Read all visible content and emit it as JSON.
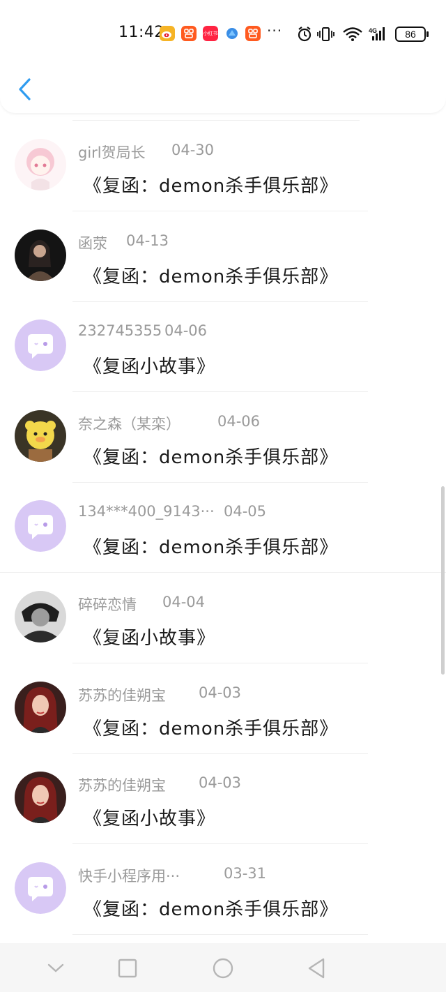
{
  "status_bar": {
    "time": "11:42",
    "network": "4G",
    "battery": "86",
    "overflow": "···",
    "apps": [
      {
        "icon": "weibo-icon",
        "color": "#f5a623"
      },
      {
        "icon": "kuaishou-icon",
        "color": "#ff5a1f"
      },
      {
        "icon": "xiaohongshu-icon",
        "color": "#ff2442",
        "text": "小红书"
      },
      {
        "icon": "browser-icon",
        "color": "#3a8ee6"
      },
      {
        "icon": "kuaishou-icon",
        "color": "#ff5a1f"
      }
    ]
  },
  "header": {
    "back_icon": "chevron-left-icon",
    "accent": "#2f9cf0"
  },
  "messages": [
    {
      "name": "girl贺局长",
      "date": "04-30",
      "title": "《复函：demon杀手俱乐部》",
      "avatar": "anime-girl"
    },
    {
      "name": "函荥",
      "date": "04-13",
      "title": "《复函：demon杀手俱乐部》",
      "avatar": "photo-dark"
    },
    {
      "name": "232745355",
      "date": "04-06",
      "title": "《复函小故事》",
      "avatar": "default-chat"
    },
    {
      "name": "奈之森（某栾）",
      "date": "04-06",
      "title": "《复函：demon杀手俱乐部》",
      "avatar": "plush-toy"
    },
    {
      "name": "134***400_9143···",
      "date": "04-05",
      "title": "《复函：demon杀手俱乐部》",
      "avatar": "default-chat"
    },
    {
      "name": "碎碎恋情",
      "date": "04-04",
      "title": "《复函小故事》",
      "avatar": "photo-bw"
    },
    {
      "name": "苏苏的佳朔宝",
      "date": "04-03",
      "title": "《复函：demon杀手俱乐部》",
      "avatar": "photo-redhair"
    },
    {
      "name": "苏苏的佳朔宝",
      "date": "04-03",
      "title": "《复函小故事》",
      "avatar": "photo-redhair"
    },
    {
      "name": "快手小程序用···",
      "date": "03-31",
      "title": "《复函：demon杀手俱乐部》",
      "avatar": "default-chat"
    }
  ],
  "colors": {
    "default_avatar_bg": "#d8c8f5",
    "name_text": "#9a9a9a",
    "title_text": "#1a1a1a"
  },
  "nav_bar": {
    "buttons": [
      "chevron-down-icon",
      "square-recent-icon",
      "circle-home-icon",
      "triangle-back-icon"
    ]
  }
}
